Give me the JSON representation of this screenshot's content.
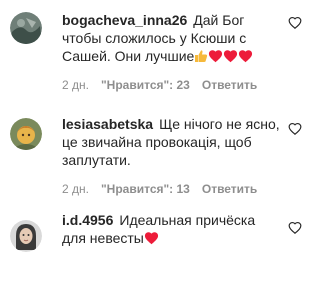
{
  "comments": [
    {
      "username": "bogacheva_inna26",
      "text": "Дай Бог чтобы сложилось у Ксюши с Сашей. Они лучшие",
      "age": "2 дн.",
      "likes": "\"Нравится\": 23",
      "reply": "Ответить",
      "icons": [
        "thumbs-up-emoji",
        "red-heart-emoji",
        "red-heart-emoji",
        "red-heart-emoji"
      ]
    },
    {
      "username": "lesiasabetska",
      "text": "Ще нічого не ясно, це звичайна провокація, щоб заплутати.",
      "age": "2 дн.",
      "likes": "\"Нравится\": 13",
      "reply": "Ответить"
    },
    {
      "username": "i.d.4956",
      "text": "Идеальная причёска для невесты",
      "icons": [
        "red-heart-emoji"
      ]
    }
  ],
  "colors": {
    "text": "#262626",
    "meta": "#8e8e8e",
    "heart_emoji": "#ed1c3a",
    "thumbs_emoji": "#f6b93b"
  }
}
